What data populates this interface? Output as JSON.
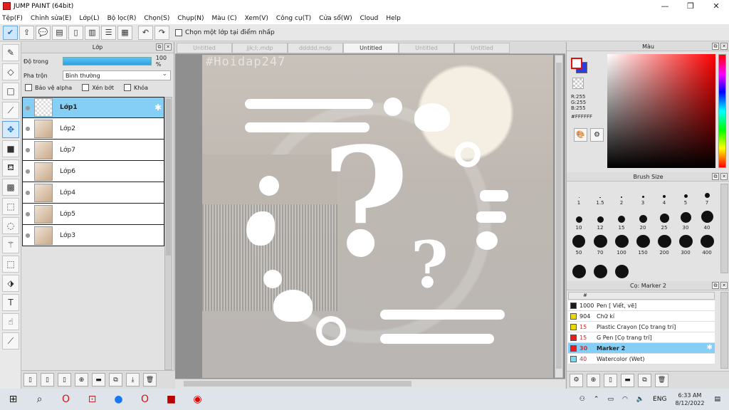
{
  "window": {
    "title": "JUMP PAINT (64bit)",
    "min": "—",
    "max": "❐",
    "close": "✕"
  },
  "menu": [
    "Tệp(F)",
    "Chỉnh sửa(E)",
    "Lớp(L)",
    "Bộ lọc(R)",
    "Chọn(S)",
    "Chụp(N)",
    "Màu (C)",
    "Xem(V)",
    "Công cụ(T)",
    "Cửa sổ(W)",
    "Cloud",
    "Help"
  ],
  "toolbar": {
    "select_layer_label": "Chọn một lớp tại điểm nhấp"
  },
  "layer_panel": {
    "title": "Lớp",
    "opacity_label": "Độ trong",
    "opacity_value": "100 %",
    "opacity_fraction": 1.0,
    "blend_label": "Pha trộn",
    "blend_value": "Bình thường",
    "protect_alpha": "Bảo vệ alpha",
    "clip": "Xén bớt",
    "lock": "Khóa",
    "layers": [
      {
        "name": "Lớp1",
        "selected": true
      },
      {
        "name": "Lớp2",
        "selected": false
      },
      {
        "name": "Lớp7",
        "selected": false
      },
      {
        "name": "Lớp6",
        "selected": false
      },
      {
        "name": "Lớp4",
        "selected": false
      },
      {
        "name": "Lớp5",
        "selected": false
      },
      {
        "name": "Lớp3",
        "selected": false
      }
    ]
  },
  "tabs": [
    {
      "label": "Untitled",
      "active": false
    },
    {
      "label": "jjk;l;.mdp",
      "active": false
    },
    {
      "label": "ddddd.mdp",
      "active": false
    },
    {
      "label": "Untitled",
      "active": true
    },
    {
      "label": "Untitled",
      "active": false
    },
    {
      "label": "Untitled",
      "active": false
    }
  ],
  "canvas": {
    "watermark": "#Hoidap247"
  },
  "color_panel": {
    "title": "Màu",
    "r": "R:255",
    "g": "G:255",
    "b": "B:255",
    "hex": "#FFFFFF",
    "fg_color": "#FFFFFF",
    "bg_color": "#2A3EE0"
  },
  "brush_panel": {
    "title": "Brush Size",
    "sizes": [
      "1",
      "1.5",
      "2",
      "3",
      "4",
      "5",
      "7",
      "10",
      "12",
      "15",
      "20",
      "25",
      "30",
      "40",
      "50",
      "70",
      "100",
      "150",
      "200",
      "300",
      "400",
      "",
      "",
      ""
    ]
  },
  "tool_panel": {
    "title": "Cọ: Marker 2",
    "header_num": "#",
    "items": [
      {
        "size": "1000",
        "name": "Pen [ Viết, vẽ]",
        "color": "#1a1a1a",
        "selected": false
      },
      {
        "size": "904",
        "name": "Chữ kí",
        "color": "#e8d80a",
        "selected": false
      },
      {
        "size": "15",
        "name": "Plastic Crayon [Cọ trang trí]",
        "color": "#e8d80a",
        "selected": false
      },
      {
        "size": "15",
        "name": "G Pen [Cọ trang trí]",
        "color": "#e02020",
        "selected": false
      },
      {
        "size": "30",
        "name": "Marker 2",
        "color": "#e02020",
        "selected": true
      },
      {
        "size": "40",
        "name": "Watercolor (Wet)",
        "color": "#7fd8f0",
        "selected": false
      }
    ]
  },
  "taskbar": {
    "lang": "ENG",
    "time": "6:33 AM",
    "date": "8/12/2022"
  }
}
